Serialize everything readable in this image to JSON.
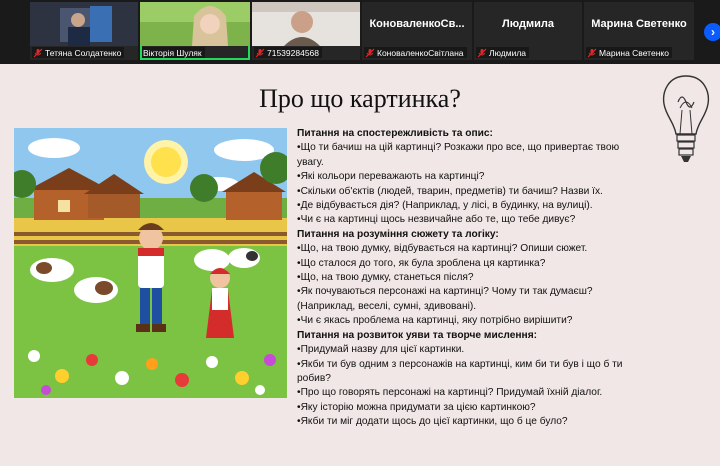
{
  "participants": [
    {
      "name": "Тетяна Солдатенко",
      "big": "",
      "muted": true
    },
    {
      "name": "Вікторія Шуляк",
      "big": "",
      "muted": false,
      "active": true
    },
    {
      "name": "71539284568",
      "big": "",
      "muted": true
    },
    {
      "name": "КоноваленкоСвітлана",
      "big": "КоноваленкоСв...",
      "muted": true
    },
    {
      "name": "Людмила",
      "big": "Людмила",
      "muted": true
    },
    {
      "name": "Марина Светенко",
      "big": "Марина Светенко",
      "muted": true
    }
  ],
  "nav": {
    "next_icon": "chevron-right-icon",
    "glyph": "›"
  },
  "slide": {
    "title": "Про що картинка?",
    "lines": [
      {
        "text": "Питання на спостережливість та опис:",
        "heading": true
      },
      {
        "text": "•Що ти бачиш на цій картинці? Розкажи про все, що привертає твою"
      },
      {
        "text": "увагу."
      },
      {
        "text": "•Які кольори переважають на картинці?"
      },
      {
        "text": "•Скільки об'єктів (людей, тварин, предметів) ти бачиш? Назви їх."
      },
      {
        "text": "•Де відбувається дія? (Наприклад, у лісі, в будинку, на вулиці)."
      },
      {
        "text": "•Чи є на картинці щось незвичайне або те, що тебе дивує?"
      },
      {
        "text": "Питання на розуміння сюжету та логіку:",
        "heading": true
      },
      {
        "text": "•Що, на твою думку, відбувається на картинці? Опиши сюжет."
      },
      {
        "text": "•Що сталося до того, як була зроблена ця картинка?"
      },
      {
        "text": "•Що, на твою думку, станеться після?"
      },
      {
        "text": "•Як почуваються персонажі на картинці? Чому ти так думаєш?"
      },
      {
        "text": "(Наприклад, веселі, сумні, здивовані)."
      },
      {
        "text": "•Чи є якась проблема на картинці, яку потрібно вирішити?"
      },
      {
        "text": "Питання на розвиток уяви та творче мислення:",
        "heading": true
      },
      {
        "text": "•Придумай назву для цієї картинки."
      },
      {
        "text": "•Якби ти був одним з персонажів на картинці, ким би ти був і що б ти"
      },
      {
        "text": "робив?"
      },
      {
        "text": "•Про що говорять персонажі на картинці? Придумай їхній діалог."
      },
      {
        "text": "•Яку історію можна придумати за цією картинкою?"
      },
      {
        "text": "•Якби ти міг додати щось до цієї картинки, що б це було?"
      }
    ]
  },
  "colors": {
    "active_border": "#23d959",
    "muted_icon": "#e02828",
    "accent": "#0b5cff"
  }
}
